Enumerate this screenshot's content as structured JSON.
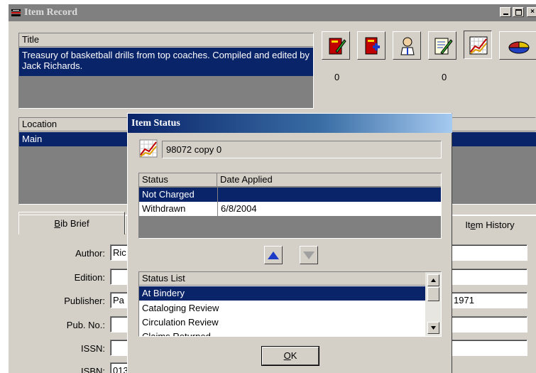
{
  "window": {
    "title": "Item Record"
  },
  "title_panel": {
    "header": "Title",
    "value": "Treasury of basketball drills from top coaches. Compiled and edited by Jack Richards."
  },
  "toolbar": {
    "counts": [
      "0",
      "0"
    ]
  },
  "location_panel": {
    "header": "Location",
    "value": "Main"
  },
  "tabs": {
    "bib_brief": "Bib Brief",
    "bib_brief_accel": "B",
    "bib_brief_rest": "ib Brief",
    "item_history_pre": "It",
    "item_history_accel": "e",
    "item_history_rest": "m History"
  },
  "fields": {
    "author_label": "Author:",
    "author_value": "Ric",
    "edition_label": "Edition:",
    "edition_value": "",
    "publisher_label": "Publisher:",
    "publisher_value": "Pa",
    "publisher_year": "1971",
    "pubno_label": "Pub. No.:",
    "pubno_value": "",
    "issn_label": "ISSN:",
    "issn_value": "",
    "isbn_label": "ISBN:",
    "isbn_value": "013"
  },
  "dialog": {
    "title": "Item Status",
    "item_id": "98072 copy 0",
    "status_table": {
      "headers": [
        "Status",
        "Date Applied"
      ],
      "rows": [
        {
          "status": "Not Charged",
          "date": ""
        },
        {
          "status": "Withdrawn",
          "date": "6/8/2004"
        }
      ]
    },
    "status_list": {
      "header": "Status List",
      "items": [
        "At Bindery",
        "Cataloging Review",
        "Circulation Review",
        "Claims Returned"
      ]
    },
    "ok_accel": "O",
    "ok_rest": "K"
  },
  "colors": {
    "selection": "#0a246a",
    "face": "#d4d0c8",
    "shadow": "#808080"
  }
}
